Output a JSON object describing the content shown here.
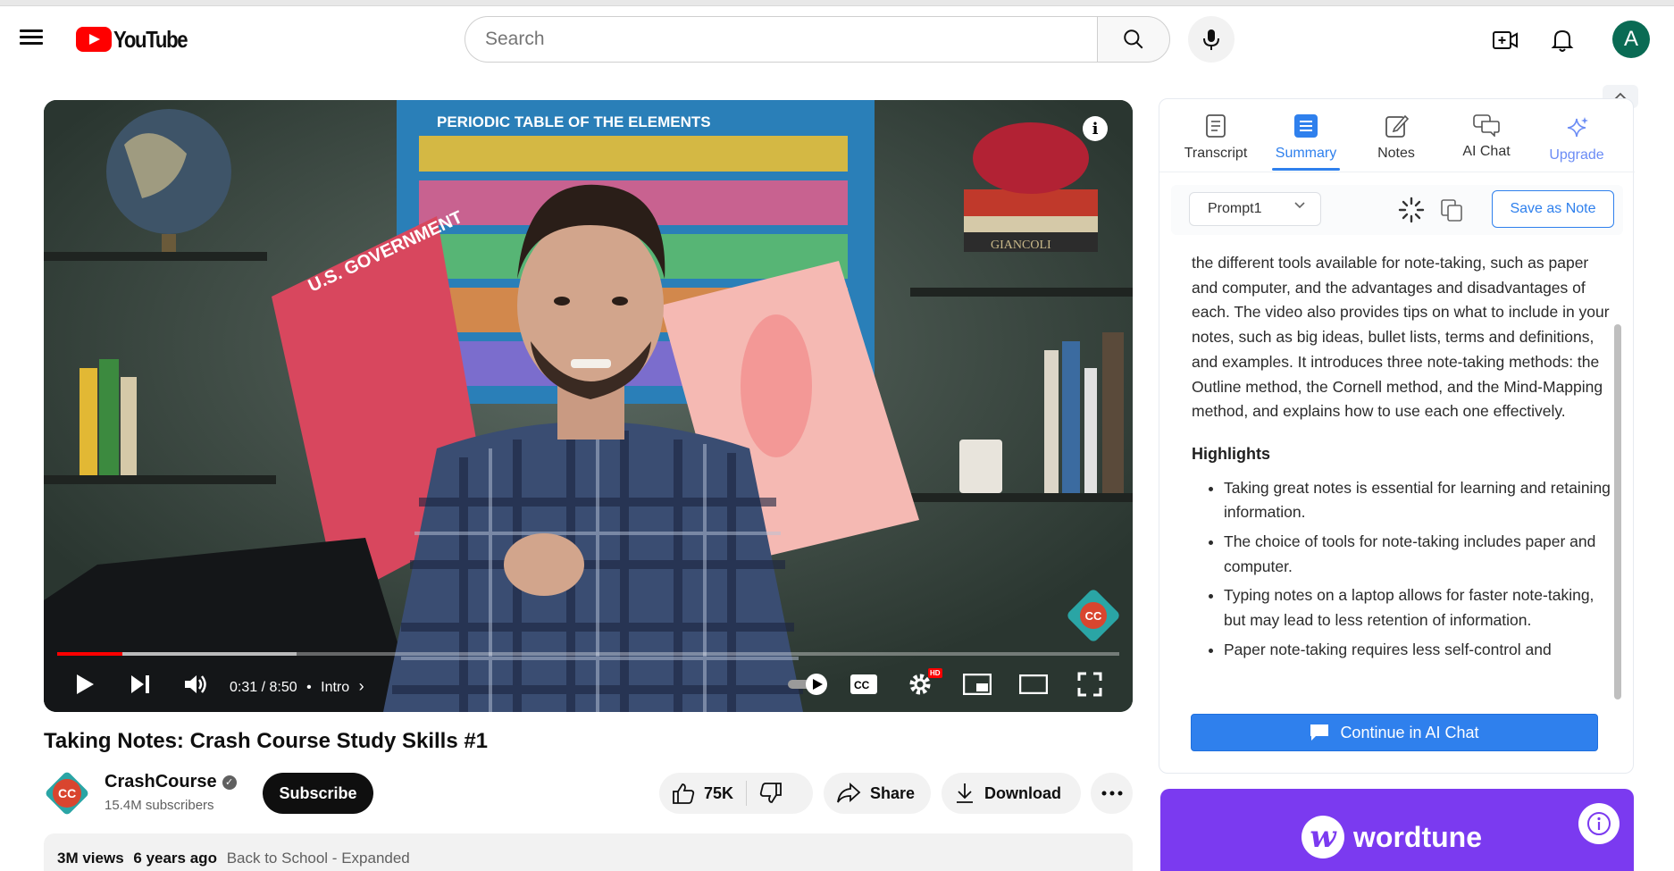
{
  "header": {
    "logo_text": "YouTube",
    "search_placeholder": "Search",
    "avatar_letter": "A"
  },
  "player": {
    "current_time": "0:31 / 8:50",
    "chapter": "Intro",
    "progress_played_fraction": 0.061,
    "progress_buffered_fraction": 0.225,
    "hd_badge": "HD",
    "channel_watermark": "CC"
  },
  "video": {
    "title": "Taking Notes: Crash Course Study Skills #1",
    "channel": "CrashCourse",
    "subscribers": "15.4M subscribers",
    "subscribe_label": "Subscribe",
    "likes": "75K",
    "share_label": "Share",
    "download_label": "Download",
    "views": "3M views",
    "age": "6 years ago",
    "playlist_tag": "Back to School - Expanded"
  },
  "panel": {
    "tabs": [
      {
        "label": "Transcript",
        "icon": "transcript-icon"
      },
      {
        "label": "Summary",
        "icon": "summary-icon",
        "active": true
      },
      {
        "label": "Notes",
        "icon": "notes-icon"
      },
      {
        "label": "AI Chat",
        "icon": "chat-icon"
      },
      {
        "label": "Upgrade",
        "icon": "sparkle-icon"
      }
    ],
    "prompt_select": "Prompt1",
    "save_as_note": "Save as Note",
    "summary_paragraph": "the different tools available for note-taking, such as paper and computer, and the advantages and disadvantages of each. The video also provides tips on what to include in your notes, such as big ideas, bullet lists, terms and definitions, and examples. It introduces three note-taking methods: the Outline method, the Cornell method, and the Mind-Mapping method, and explains how to use each one effectively.",
    "highlights_heading": "Highlights",
    "highlights": [
      "Taking great notes is essential for learning and retaining information.",
      "The choice of tools for note-taking includes paper and computer.",
      "Typing notes on a laptop allows for faster note-taking, but may lead to less retention of information.",
      "Paper note-taking requires less self-control and"
    ],
    "continue_label": "Continue in AI Chat"
  },
  "ad": {
    "brand": "wordtune",
    "brand_color": "#7b3af0"
  },
  "colors": {
    "youtube_red": "#ff0000",
    "accent_blue": "#2f80ed"
  }
}
